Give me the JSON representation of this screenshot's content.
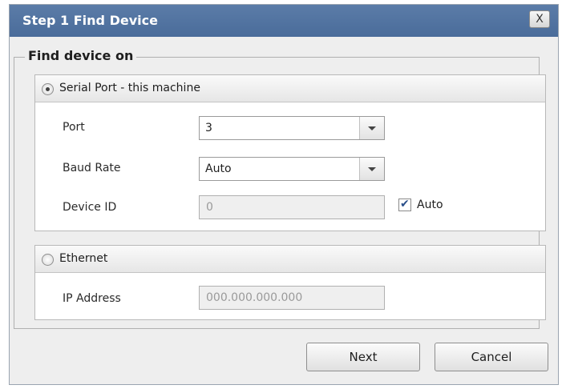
{
  "dialog": {
    "title": "Step 1 Find Device",
    "close_label": "X"
  },
  "group": {
    "legend": "Find device on"
  },
  "serial": {
    "label": "Serial Port - this machine",
    "selected": true,
    "port_label": "Port",
    "port_value": "3",
    "baud_label": "Baud Rate",
    "baud_value": "Auto",
    "device_id_label": "Device ID",
    "device_id_value": "0",
    "auto_label": "Auto",
    "auto_checked": true
  },
  "ethernet": {
    "label": "Ethernet",
    "selected": false,
    "ip_label": "IP Address",
    "ip_placeholder": "000.000.000.000"
  },
  "buttons": {
    "next": "Next",
    "cancel": "Cancel"
  }
}
